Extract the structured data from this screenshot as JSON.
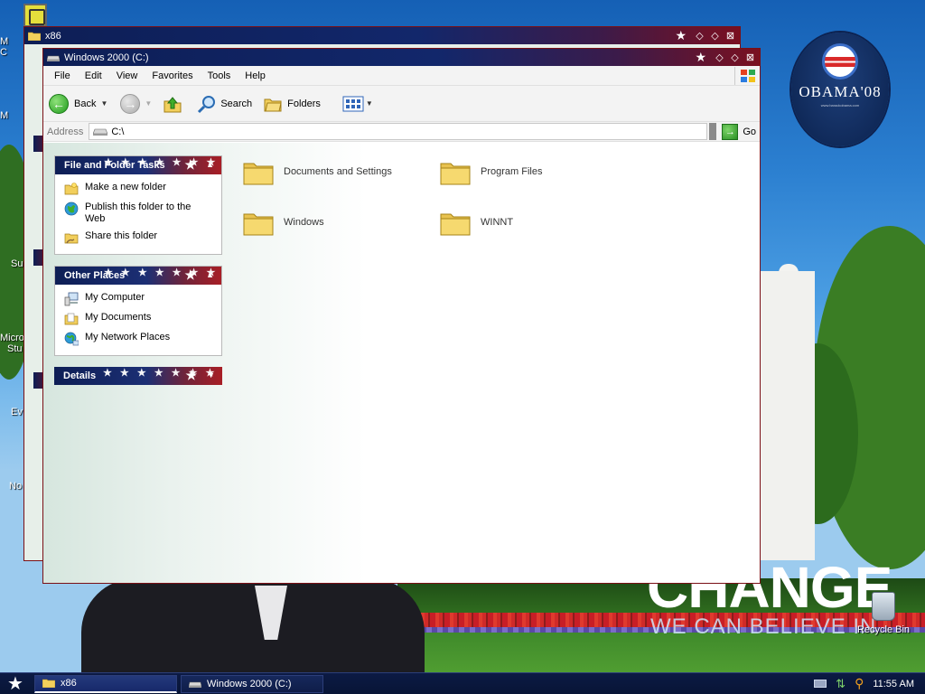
{
  "desktop": {
    "badge": {
      "name": "OBAMA'08",
      "url": "www.barackobama.com"
    },
    "slogan_main": "CHANGE",
    "slogan_sub": "WE CAN BELIEVE IN",
    "recycle_bin_label": "Recycle Bin",
    "left_labels": [
      "M",
      "C",
      "M",
      "Su",
      "Micro",
      "Stu",
      "Ev",
      "No"
    ]
  },
  "back_window": {
    "title": "x86"
  },
  "window": {
    "title": "Windows 2000 (C:)",
    "menu": [
      "File",
      "Edit",
      "View",
      "Favorites",
      "Tools",
      "Help"
    ],
    "toolbar": {
      "back_label": "Back",
      "search_label": "Search",
      "folders_label": "Folders"
    },
    "address": {
      "label": "Address",
      "value": "C:\\",
      "go_label": "Go"
    },
    "panels": [
      {
        "title": "File and Folder Tasks",
        "items": [
          {
            "label": "Make a new folder",
            "icon": "new-folder-icon"
          },
          {
            "label": "Publish this folder to the Web",
            "icon": "globe-icon"
          },
          {
            "label": "Share this folder",
            "icon": "share-folder-icon"
          }
        ]
      },
      {
        "title": "Other Places",
        "items": [
          {
            "label": "My Computer",
            "icon": "computer-icon"
          },
          {
            "label": "My Documents",
            "icon": "documents-icon"
          },
          {
            "label": "My Network Places",
            "icon": "network-icon"
          }
        ]
      },
      {
        "title": "Details",
        "items": []
      }
    ],
    "folders": [
      "Documents and Settings",
      "Program Files",
      "Windows",
      "WINNT"
    ]
  },
  "taskbar": {
    "tasks": [
      "x86",
      "Windows 2000 (C:)"
    ],
    "clock": "11:55 AM"
  },
  "colors": {
    "title_navy": "#0d1e55",
    "title_red": "#a81e25",
    "folder_yellow": "#f2cf5c"
  }
}
